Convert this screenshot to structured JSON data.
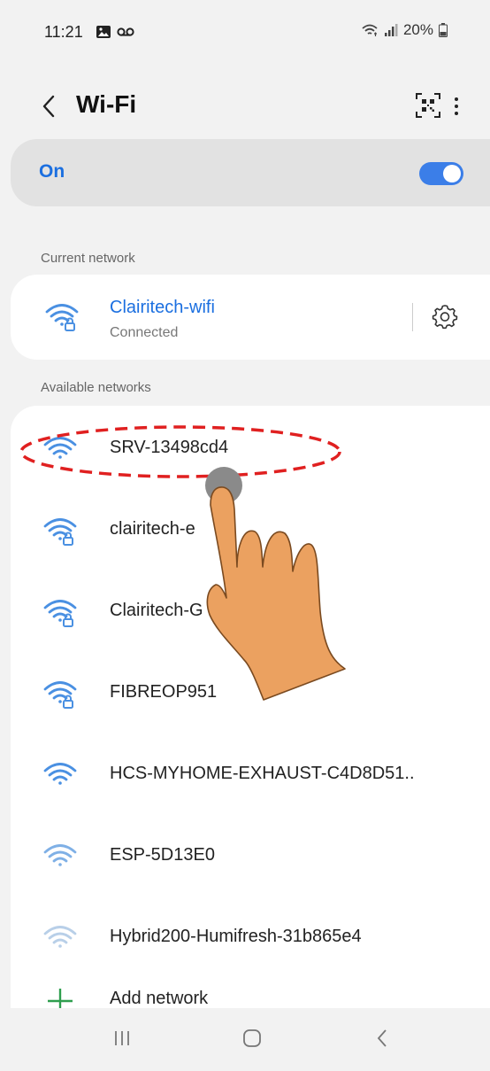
{
  "status_bar": {
    "time": "11:21",
    "left_icons": [
      "gallery-icon",
      "voicemail-icon"
    ],
    "right_icons": [
      "wifi-status-icon",
      "signal-icon"
    ],
    "battery": "20%"
  },
  "header": {
    "title": "Wi-Fi",
    "back_icon": "chevron-left-icon",
    "qr_icon": "qr-scan-icon",
    "more_icon": "more-vertical-icon"
  },
  "wifi_toggle": {
    "label": "On",
    "state": true
  },
  "current_network": {
    "section_label": "Current network",
    "name": "Clairitech-wifi",
    "status": "Connected",
    "secured": true,
    "settings_icon": "gear-icon"
  },
  "available_networks": {
    "section_label": "Available networks",
    "items": [
      {
        "name": "SRV-13498cd4",
        "secured": false,
        "strength": "strong"
      },
      {
        "name": "clairitech-e",
        "secured": true,
        "strength": "strong"
      },
      {
        "name": "Clairitech-G",
        "secured": true,
        "strength": "strong"
      },
      {
        "name": "FIBREOP951",
        "secured": true,
        "strength": "strong"
      },
      {
        "name": "HCS-MYHOME-EXHAUST-C4D8D51..",
        "secured": false,
        "strength": "strong"
      },
      {
        "name": "ESP-5D13E0",
        "secured": false,
        "strength": "medium"
      },
      {
        "name": "Hybrid200-Humifresh-31b865e4",
        "secured": false,
        "strength": "weak"
      }
    ],
    "add_network_label": "Add network"
  },
  "nav_bar": {
    "recents_icon": "recents-icon",
    "home_icon": "home-icon",
    "back_icon": "back-icon"
  },
  "colors": {
    "accent": "#1b6fe0",
    "toggle": "#3b7ee8",
    "wifi_icon_strong": "#4a90e2",
    "wifi_icon_weak": "#b8cfe8",
    "annotation_red": "#e02020",
    "hand": "#e8a060"
  },
  "annotation": {
    "highlight": "dashed-ellipse",
    "pointer": "hand-tap-icon"
  }
}
